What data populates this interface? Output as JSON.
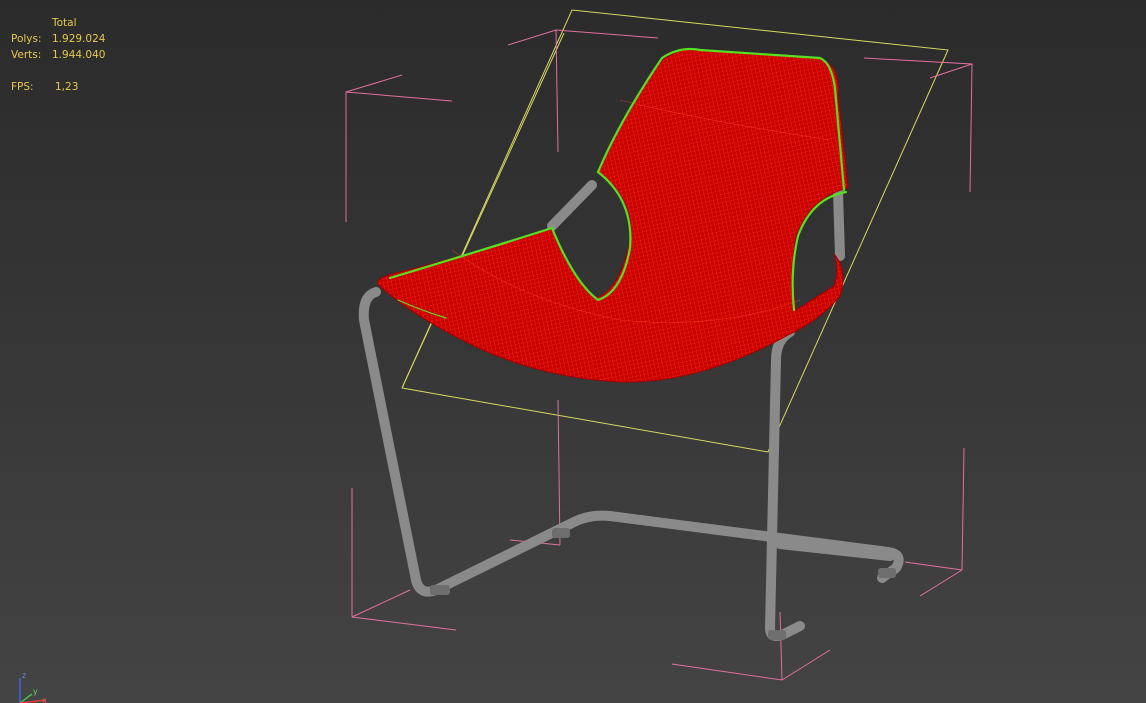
{
  "stats": {
    "header": "Total",
    "polys_label": "Polys:",
    "polys_value": "1.929.024",
    "verts_label": "Verts:",
    "verts_value": "1.944.040",
    "fps_label": "FPS:",
    "fps_value": "1,23"
  },
  "axis_gizmo": {
    "z_label": "z",
    "y_label": "y",
    "x_label": "x"
  },
  "colors": {
    "stats_text": "#e6c84a",
    "seat_fill": "#c40000",
    "seat_wire": "#ff2a1a",
    "selection_edge": "#55e020",
    "frame": "#8a8a8a",
    "selection_bracket": "#e070a0",
    "gizmo_box": "#d8d860"
  }
}
